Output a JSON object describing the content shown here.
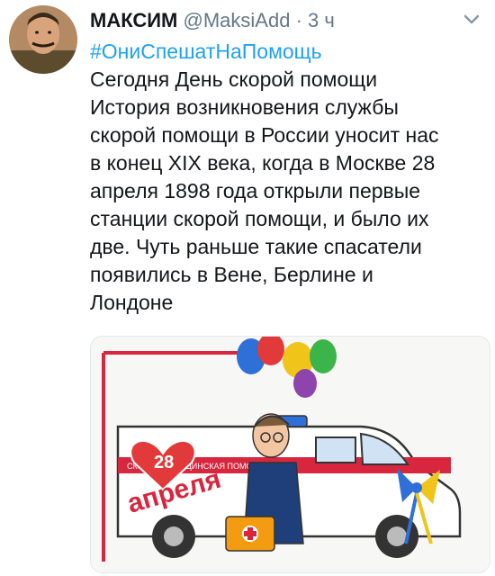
{
  "tweet": {
    "author_name": "МАКСИМ",
    "handle": "@MaksiAdd",
    "separator": "·",
    "time": "3 ч",
    "hashtag": "#ОниСпешатНаПомощь",
    "lines": [
      "Сегодня День скорой помощи",
      "История возникновения службы",
      "скорой помощи в России уносит нас",
      "в конец XIX века, когда в Москве 28",
      "апреля 1898 года открыли первые",
      "станции скорой помощи, и было их",
      "две. Чуть раньше такие спасатели",
      "появились в Вене, Берлине и",
      "Лондоне"
    ]
  },
  "media": {
    "heart_number": "28",
    "arc_text": "апреля",
    "van_text": "СКОРАЯ МЕДИЦИНСКАЯ ПОМОЩЬ"
  },
  "icons": {
    "avatar": "avatar-photo",
    "caret": "chevron-down-icon",
    "medical_cross": "cross-icon"
  },
  "colors": {
    "hashtag": "#1da1f2",
    "muted": "#657786",
    "text": "#14171a"
  }
}
